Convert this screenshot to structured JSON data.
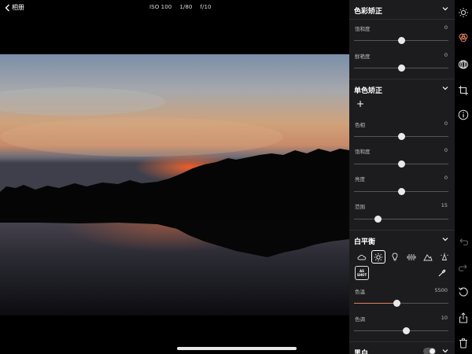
{
  "topbar": {
    "back_label": "相册",
    "iso": "ISO 100",
    "shutter": "1/80",
    "aperture": "f/10"
  },
  "panel": {
    "color_correction": {
      "title": "色彩矫正",
      "saturation": {
        "label": "饱和度",
        "value": "0",
        "level": 0.5
      },
      "vibrance": {
        "label": "鲜艳度",
        "value": "0",
        "level": 0.5
      }
    },
    "single_color": {
      "title": "单色矫正",
      "add_label": "+",
      "hue": {
        "label": "色相",
        "value": "0",
        "level": 0.5
      },
      "saturation": {
        "label": "饱和度",
        "value": "0",
        "level": 0.5
      },
      "luminance": {
        "label": "亮度",
        "value": "0",
        "level": 0.5
      },
      "range": {
        "label": "范围",
        "value": "15",
        "level": 0.25
      }
    },
    "white_balance": {
      "title": "白平衡",
      "presets": [
        "cloudy-icon",
        "sunny-icon",
        "tungsten-icon",
        "fluorescent-icon",
        "shade-icon",
        "flash-icon"
      ],
      "active_preset": "sunny-icon",
      "as_shot_line1": "AS",
      "as_shot_line2": "SHOT",
      "temperature": {
        "label": "色温",
        "value": "5500",
        "level": 0.45
      },
      "tint": {
        "label": "色调",
        "value": "10",
        "level": 0.55
      }
    },
    "bw": {
      "title": "黑白",
      "enabled": false
    }
  },
  "toolbar": {
    "tools": [
      "sun-icon",
      "color-icon",
      "hsl-icon",
      "crop-icon",
      "info-icon",
      "undo-icon",
      "redo-icon",
      "reset-icon",
      "share-icon",
      "delete-icon"
    ],
    "active_tool": "color-icon",
    "accent": "#e0825a"
  }
}
